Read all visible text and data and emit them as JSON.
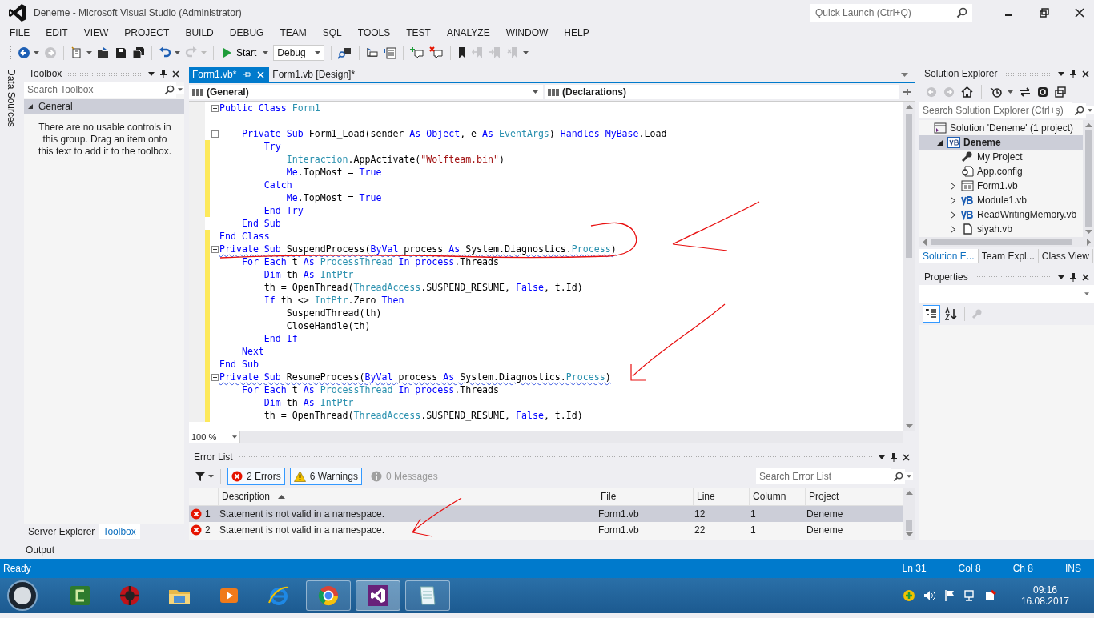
{
  "window": {
    "title": "Deneme - Microsoft Visual Studio (Administrator)",
    "quick_launch": {
      "placeholder": "Quick Launch (Ctrl+Q)"
    }
  },
  "menu": [
    "FILE",
    "EDIT",
    "VIEW",
    "PROJECT",
    "BUILD",
    "DEBUG",
    "TEAM",
    "SQL",
    "TOOLS",
    "TEST",
    "ANALYZE",
    "WINDOW",
    "HELP"
  ],
  "toolbar": {
    "nav": [
      {
        "disabled": false
      },
      {
        "disabled": true
      }
    ],
    "start_label": "Start",
    "configuration": "Debug"
  },
  "side_strip": {
    "label": "Data Sources"
  },
  "toolbox": {
    "title": "Toolbox",
    "search": {
      "placeholder": "Search Toolbox"
    },
    "group": {
      "label": "General",
      "expanded": true
    },
    "message": "There are no usable controls in this group. Drag an item onto this text to add it to the toolbox.",
    "tabs": [
      {
        "label": "Server Explorer",
        "selected": false
      },
      {
        "label": "Toolbox",
        "selected": true
      }
    ]
  },
  "editor": {
    "tabs": [
      {
        "label": "Form1.vb*",
        "selected": true
      },
      {
        "label": "Form1.vb [Design]*",
        "selected": false
      }
    ],
    "navigation": [
      "(General)",
      "(Declarations)"
    ],
    "lines": [
      {
        "collapsible": true,
        "changed": false,
        "tokens": [
          {
            "text": "Public Class ",
            "kind": "kw"
          },
          {
            "text": "Form1",
            "kind": "type"
          }
        ]
      },
      {
        "changed": false
      },
      {
        "collapsible": true,
        "changed": false,
        "tokens": [
          {
            "text": "    Private Sub ",
            "kind": "kw"
          },
          {
            "text": "Form1_Load(sender ",
            "kind": "plain"
          },
          {
            "text": "As Object",
            "kind": "kw"
          },
          {
            "text": ", e ",
            "kind": "plain"
          },
          {
            "text": "As ",
            "kind": "kw"
          },
          {
            "text": "EventArgs",
            "kind": "type"
          },
          {
            "text": ") ",
            "kind": "plain"
          },
          {
            "text": "Handles MyBase",
            "kind": "kw"
          },
          {
            "text": ".Load",
            "kind": "plain"
          }
        ]
      },
      {
        "changed": true,
        "tokens": [
          {
            "text": "        Try",
            "kind": "kw"
          }
        ]
      },
      {
        "changed": true,
        "tokens": [
          {
            "text": "            Interaction",
            "kind": "type"
          },
          {
            "text": ".AppActivate(",
            "kind": "plain"
          },
          {
            "text": "\"Wolfteam.bin\"",
            "kind": "str"
          },
          {
            "text": ")",
            "kind": "plain"
          }
        ]
      },
      {
        "changed": true,
        "tokens": [
          {
            "text": "            Me",
            "kind": "kw"
          },
          {
            "text": ".TopMost = ",
            "kind": "plain"
          },
          {
            "text": "True",
            "kind": "kw"
          }
        ]
      },
      {
        "changed": true,
        "tokens": [
          {
            "text": "        Catch",
            "kind": "kw"
          }
        ]
      },
      {
        "changed": true,
        "tokens": [
          {
            "text": "            Me",
            "kind": "kw"
          },
          {
            "text": ".TopMost = ",
            "kind": "plain"
          },
          {
            "text": "True",
            "kind": "kw"
          }
        ]
      },
      {
        "changed": true,
        "tokens": [
          {
            "text": "        End Try",
            "kind": "kw"
          }
        ]
      },
      {
        "changed": false,
        "tokens": [
          {
            "text": "    End Sub",
            "kind": "kw"
          }
        ]
      },
      {
        "changed": true,
        "tokens": [
          {
            "text": "End Class",
            "kind": "kw"
          }
        ]
      },
      {
        "collapsible": true,
        "separator": true,
        "error": true,
        "changed": true,
        "tokens": [
          {
            "text": "Private Sub ",
            "kind": "kw"
          },
          {
            "text": "SuspendProcess(",
            "kind": "plain"
          },
          {
            "text": "ByVal",
            "kind": "kw"
          },
          {
            "text": " process ",
            "kind": "plain"
          },
          {
            "text": "As ",
            "kind": "kw"
          },
          {
            "text": "System.Diagnostics.",
            "kind": "plain"
          },
          {
            "text": "Process",
            "kind": "type"
          },
          {
            "text": ")",
            "kind": "plain"
          }
        ]
      },
      {
        "changed": true,
        "tokens": [
          {
            "text": "    For Each ",
            "kind": "kw"
          },
          {
            "text": "t ",
            "kind": "plain"
          },
          {
            "text": "As ",
            "kind": "kw"
          },
          {
            "text": "ProcessThread ",
            "kind": "type"
          },
          {
            "text": "In process",
            "kind": "kw"
          },
          {
            "text": ".Threads",
            "kind": "plain"
          }
        ]
      },
      {
        "changed": true,
        "tokens": [
          {
            "text": "        Dim ",
            "kind": "kw"
          },
          {
            "text": "th ",
            "kind": "plain"
          },
          {
            "text": "As ",
            "kind": "kw"
          },
          {
            "text": "IntPtr",
            "kind": "type"
          }
        ]
      },
      {
        "changed": true,
        "tokens": [
          {
            "text": "        th = OpenThread(",
            "kind": "plain"
          },
          {
            "text": "ThreadAccess",
            "kind": "type"
          },
          {
            "text": ".SUSPEND_RESUME, ",
            "kind": "plain"
          },
          {
            "text": "False",
            "kind": "kw"
          },
          {
            "text": ", t.Id)",
            "kind": "plain"
          }
        ]
      },
      {
        "changed": true,
        "tokens": [
          {
            "text": "        If ",
            "kind": "kw"
          },
          {
            "text": "th <> ",
            "kind": "plain"
          },
          {
            "text": "IntPtr",
            "kind": "type"
          },
          {
            "text": ".Zero ",
            "kind": "plain"
          },
          {
            "text": "Then",
            "kind": "kw"
          }
        ]
      },
      {
        "changed": true,
        "tokens": [
          {
            "text": "            SuspendThread(th)",
            "kind": "plain"
          }
        ]
      },
      {
        "changed": true,
        "tokens": [
          {
            "text": "            CloseHandle(th)",
            "kind": "plain"
          }
        ]
      },
      {
        "changed": true,
        "tokens": [
          {
            "text": "        End If",
            "kind": "kw"
          }
        ]
      },
      {
        "changed": true,
        "tokens": [
          {
            "text": "    Next",
            "kind": "kw"
          }
        ]
      },
      {
        "changed": true,
        "tokens": [
          {
            "text": "End Sub",
            "kind": "kw"
          }
        ]
      },
      {
        "collapsible": true,
        "separator": true,
        "error": true,
        "changed": true,
        "tokens": [
          {
            "text": "Private Sub ",
            "kind": "kw"
          },
          {
            "text": "ResumeProcess(",
            "kind": "plain"
          },
          {
            "text": "ByVal",
            "kind": "kw"
          },
          {
            "text": " process ",
            "kind": "plain"
          },
          {
            "text": "As ",
            "kind": "kw"
          },
          {
            "text": "System.Diagnostics.",
            "kind": "plain"
          },
          {
            "text": "Process",
            "kind": "type"
          },
          {
            "text": ")",
            "kind": "plain"
          }
        ]
      },
      {
        "changed": true,
        "tokens": [
          {
            "text": "    For Each ",
            "kind": "kw"
          },
          {
            "text": "t ",
            "kind": "plain"
          },
          {
            "text": "As ",
            "kind": "kw"
          },
          {
            "text": "ProcessThread ",
            "kind": "type"
          },
          {
            "text": "In process",
            "kind": "kw"
          },
          {
            "text": ".Threads",
            "kind": "plain"
          }
        ]
      },
      {
        "changed": true,
        "tokens": [
          {
            "text": "        Dim ",
            "kind": "kw"
          },
          {
            "text": "th ",
            "kind": "plain"
          },
          {
            "text": "As ",
            "kind": "kw"
          },
          {
            "text": "IntPtr",
            "kind": "type"
          }
        ]
      },
      {
        "changed": true,
        "tokens": [
          {
            "text": "        th = OpenThread(",
            "kind": "plain"
          },
          {
            "text": "ThreadAccess",
            "kind": "type"
          },
          {
            "text": ".SUSPEND_RESUME, ",
            "kind": "plain"
          },
          {
            "text": "False",
            "kind": "kw"
          },
          {
            "text": ", t.Id)",
            "kind": "plain"
          }
        ]
      }
    ],
    "zoom": "100 %"
  },
  "error_list": {
    "title": "Error List",
    "filters": [
      {
        "label": "2 Errors",
        "kind": "error",
        "on": true
      },
      {
        "label": "6 Warnings",
        "kind": "warning",
        "on": true
      },
      {
        "label": "0 Messages",
        "kind": "message",
        "on": false
      }
    ],
    "search": {
      "placeholder": "Search Error List"
    },
    "columns": [
      {
        "label": "Description",
        "sorted": true
      },
      {
        "label": "File",
        "sorted": false
      },
      {
        "label": "Line",
        "sorted": false
      },
      {
        "label": "Column",
        "sorted": false
      },
      {
        "label": "Project",
        "sorted": false
      }
    ],
    "rows": [
      {
        "kind": "error",
        "index": "1",
        "description": "Statement is not valid in a namespace.",
        "file": "Form1.vb",
        "line": "12",
        "column": "1",
        "project": "Deneme",
        "selected": true
      },
      {
        "kind": "error",
        "index": "2",
        "description": "Statement is not valid in a namespace.",
        "file": "Form1.vb",
        "line": "22",
        "column": "1",
        "project": "Deneme",
        "selected": false
      }
    ]
  },
  "solution_explorer": {
    "title": "Solution Explorer",
    "search": {
      "placeholder": "Search Solution Explorer (Ctrl+ş)"
    },
    "tree": [
      {
        "label": "Solution 'Deneme' (1 project)",
        "kind": "solution",
        "selected": false,
        "children": [
          {
            "label": "Deneme",
            "kind": "project",
            "selected": true,
            "expanded": true,
            "children": [
              {
                "label": "My Project",
                "kind": "properties",
                "selected": false
              },
              {
                "label": "App.config",
                "kind": "config",
                "selected": false
              },
              {
                "label": "Form1.vb",
                "kind": "form",
                "selected": false,
                "expanded": false
              },
              {
                "label": "Module1.vb",
                "kind": "code",
                "selected": false,
                "expanded": false
              },
              {
                "label": "ReadWritingMemory.vb",
                "kind": "code",
                "selected": false,
                "expanded": false
              },
              {
                "label": "siyah.vb",
                "kind": "file",
                "selected": false,
                "expanded": false
              }
            ]
          }
        ]
      }
    ],
    "tabs": [
      {
        "label": "Solution E...",
        "selected": true
      },
      {
        "label": "Team Expl...",
        "selected": false
      },
      {
        "label": "Class View",
        "selected": false
      }
    ]
  },
  "properties": {
    "title": "Properties"
  },
  "output_tab": "Output",
  "status_bar": {
    "left": "Ready",
    "right": [
      "Ln 31",
      "Col 8",
      "Ch 8",
      "INS"
    ]
  },
  "taskbar": {
    "apps": [
      {
        "running": false,
        "active": false
      },
      {
        "running": false,
        "active": false
      },
      {
        "running": false,
        "active": false
      },
      {
        "running": false,
        "active": false
      },
      {
        "running": false,
        "active": false
      },
      {
        "running": true,
        "active": false
      },
      {
        "running": true,
        "active": true
      },
      {
        "running": true,
        "active": false
      }
    ],
    "time": "09:16",
    "date": "16.08.2017"
  }
}
